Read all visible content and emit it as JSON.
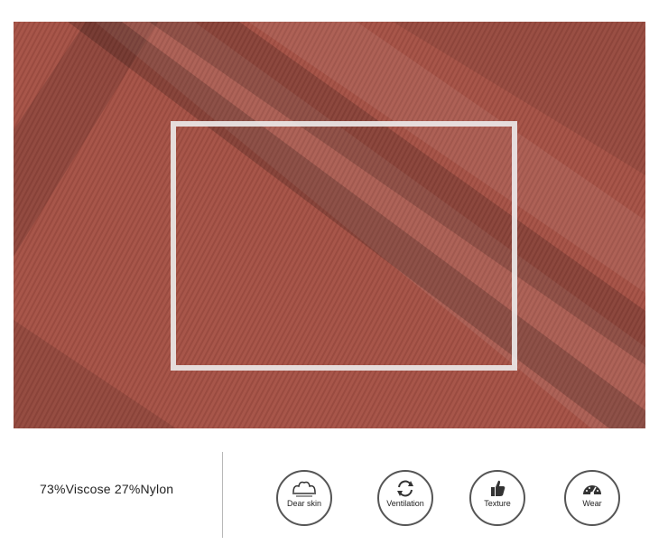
{
  "spec": {
    "composition": "73%Viscose 27%Nylon"
  },
  "features": [
    {
      "label": "Dear skin",
      "icon": "dear-skin-icon"
    },
    {
      "label": "Ventilation",
      "icon": "ventilation-icon"
    },
    {
      "label": "Texture",
      "icon": "thumbs-up-icon"
    },
    {
      "label": "Wear",
      "icon": "gauge-icon"
    }
  ],
  "colors": {
    "fabric": "#a8564a",
    "frame": "#ebe8e8"
  }
}
